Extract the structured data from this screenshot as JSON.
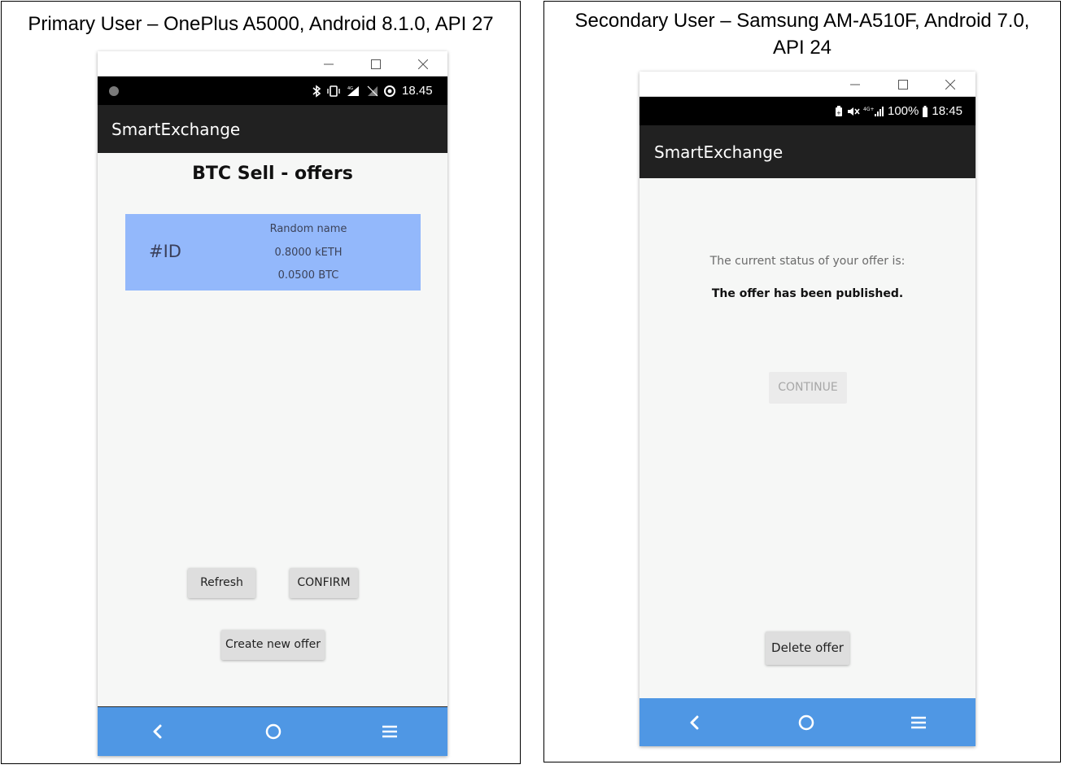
{
  "primary": {
    "caption": "Primary User – OnePlus A5000, Android 8.1.0, API 27",
    "status_time": "18.45",
    "status_icons": [
      "dot-icon",
      "bluetooth-icon",
      "vibrate-icon",
      "signal-icon",
      "no-signal-icon",
      "data-saver-icon"
    ],
    "app_title": "SmartExchange",
    "screen_title": "BTC Sell - offers",
    "offer": {
      "id": "#ID",
      "name": "Random name",
      "amount_eth": "0.8000 kETH",
      "amount_btc": "0.0500 BTC"
    },
    "buttons": {
      "refresh": "Refresh",
      "confirm": "CONFIRM",
      "create": "Create new offer"
    },
    "nav_icons": [
      "back-icon",
      "home-icon",
      "menu-icon"
    ]
  },
  "secondary": {
    "caption_line1": "Secondary User – Samsung AM-A510F, Android 7.0,",
    "caption_line2": "API 24",
    "status_battery": "100%",
    "status_time": "18:45",
    "status_icons": [
      "battery-saver-icon",
      "mute-icon",
      "lte-signal-icon",
      "battery-icon"
    ],
    "app_title": "SmartExchange",
    "status_label": "The current status of your offer is:",
    "status_value": "The offer has been published.",
    "buttons": {
      "continue": "CONTINUE",
      "delete": "Delete offer"
    },
    "nav_icons": [
      "back-icon",
      "home-icon",
      "menu-icon"
    ]
  },
  "colors": {
    "offer_card": "#93b8fb",
    "nav_bar": "#4f97e4",
    "app_bar": "#212121"
  }
}
